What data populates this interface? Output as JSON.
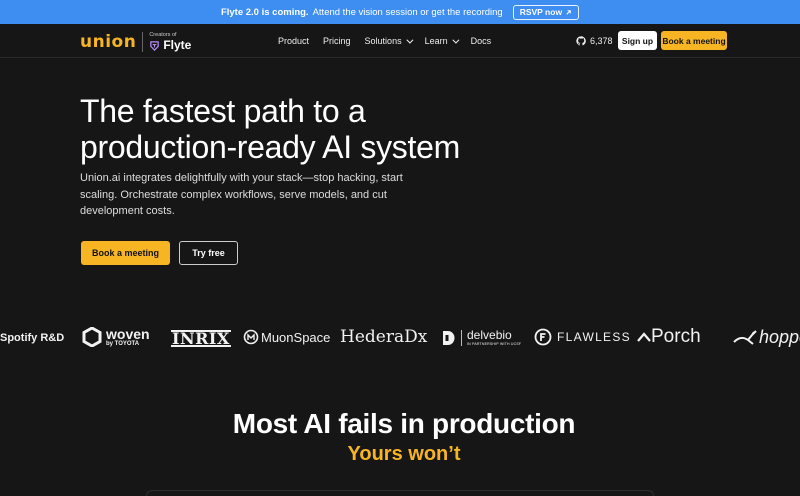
{
  "banner": {
    "headline": "Flyte 2.0 is coming.",
    "text": "Attend the vision session or get the recording",
    "rsvp_label": "RSVP now",
    "rsvp_icon": "arrow-up-right-icon"
  },
  "nav": {
    "brand": "union",
    "creators_of": "Creators of",
    "flyte": "Flyte",
    "menu": [
      "Product",
      "Pricing",
      "Solutions",
      "Learn",
      "Docs"
    ],
    "github_stars": "6,378",
    "sign_up": "Sign up",
    "book_meeting": "Book a meeting"
  },
  "hero": {
    "title": "The fastest path to a production-ready AI system",
    "subtitle": "Union.ai integrates delightfully with your stack—stop hacking, start scaling. Orchestrate complex workflows, serve models, and cut development costs.",
    "cta_primary": "Book a meeting",
    "cta_secondary": "Try free"
  },
  "customers": {
    "spotify": "Spotify R&D",
    "woven": "woven",
    "woven_sub": "by TOYOTA",
    "inrix": "INRIX",
    "muon": "MuonSpace",
    "hedera": "HederaDx",
    "delvebio": "delvebio",
    "delvebio_sub": "IN PARTNERSHIP WITH UCSF",
    "flawless": "FLAWLESS",
    "porch": "Porch",
    "hopper": "hopper"
  },
  "section": {
    "title": "Most AI fails in production",
    "subtitle": "Yours won’t"
  },
  "colors": {
    "accent": "#f7b524",
    "banner": "#3d8ef0",
    "background": "#161616"
  }
}
